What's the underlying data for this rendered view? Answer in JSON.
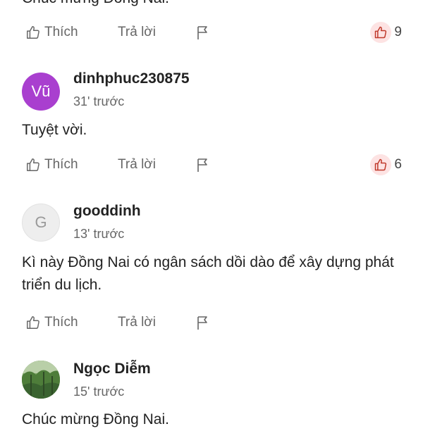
{
  "top_fragment": {
    "text": "Chúc mừng Đồng Nai."
  },
  "actions": {
    "like_label": "Thích",
    "reply_label": "Trả lời"
  },
  "comments": [
    {
      "avatar_text": "Vũ",
      "username": "dinhphuc230875",
      "time": "31' trước",
      "text": "Tuyệt vời.",
      "likes": "6",
      "avatar_color": "#a93fcf"
    },
    {
      "avatar_text": "G",
      "username": "gooddinh",
      "time": "13' trước",
      "text": "Kì này Đồng Nai có ngân sách dồi dào để xây dựng phát triển du lịch."
    },
    {
      "avatar_text": "",
      "username": "Ngọc Diễm",
      "time": "15' trước",
      "text": "Chúc mừng Đồng Nai."
    }
  ],
  "first_likes": "9",
  "colors": {
    "like_badge_bg": "#fde3e3",
    "like_icon": "#c0392b",
    "muted_text": "#666666"
  },
  "icons": [
    "thumbs-up-icon",
    "flag-icon",
    "thumbs-up-filled-icon"
  ]
}
